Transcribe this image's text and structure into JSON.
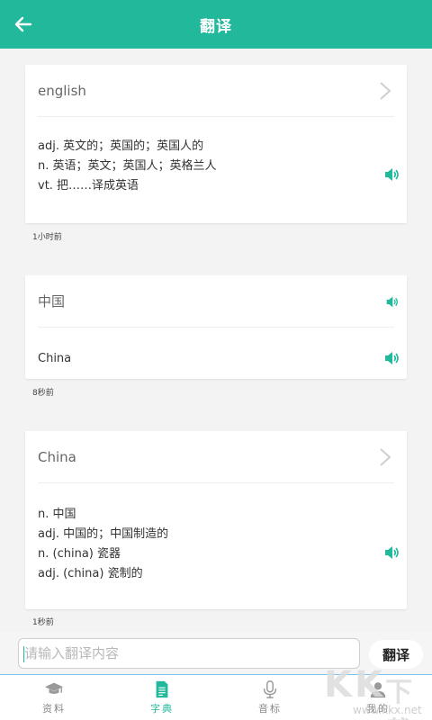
{
  "header": {
    "title": "翻译",
    "back_icon": "arrow-left-icon",
    "bg_color": "#22b89b"
  },
  "history": [
    {
      "word": "english",
      "definitions": [
        "adj. 英文的；英国的；英国人的",
        "n. 英语；英文；英国人；英格兰人",
        "vt. 把……译成英语"
      ],
      "time": "1小时前"
    },
    {
      "word": "中国",
      "definitions": [
        "China"
      ],
      "time": "8秒前"
    },
    {
      "word": "China",
      "definitions": [
        "n. 中国",
        "adj. 中国的；中国制造的",
        "n. (china) 瓷器",
        "adj. (china) 瓷制的"
      ],
      "time": "1秒前"
    }
  ],
  "input": {
    "placeholder": "请输入翻译内容",
    "value": ""
  },
  "translate_button": "翻译",
  "tabs": [
    {
      "label": "资料",
      "icon": "graduation-cap-icon",
      "active": false
    },
    {
      "label": "字典",
      "icon": "document-icon",
      "active": true
    },
    {
      "label": "音标",
      "icon": "microphone-icon",
      "active": false
    },
    {
      "label": "我的",
      "icon": "user-icon",
      "active": false
    }
  ],
  "watermark": {
    "letters": [
      "K",
      "K",
      "下载"
    ],
    "url": "www.kkx.net"
  }
}
